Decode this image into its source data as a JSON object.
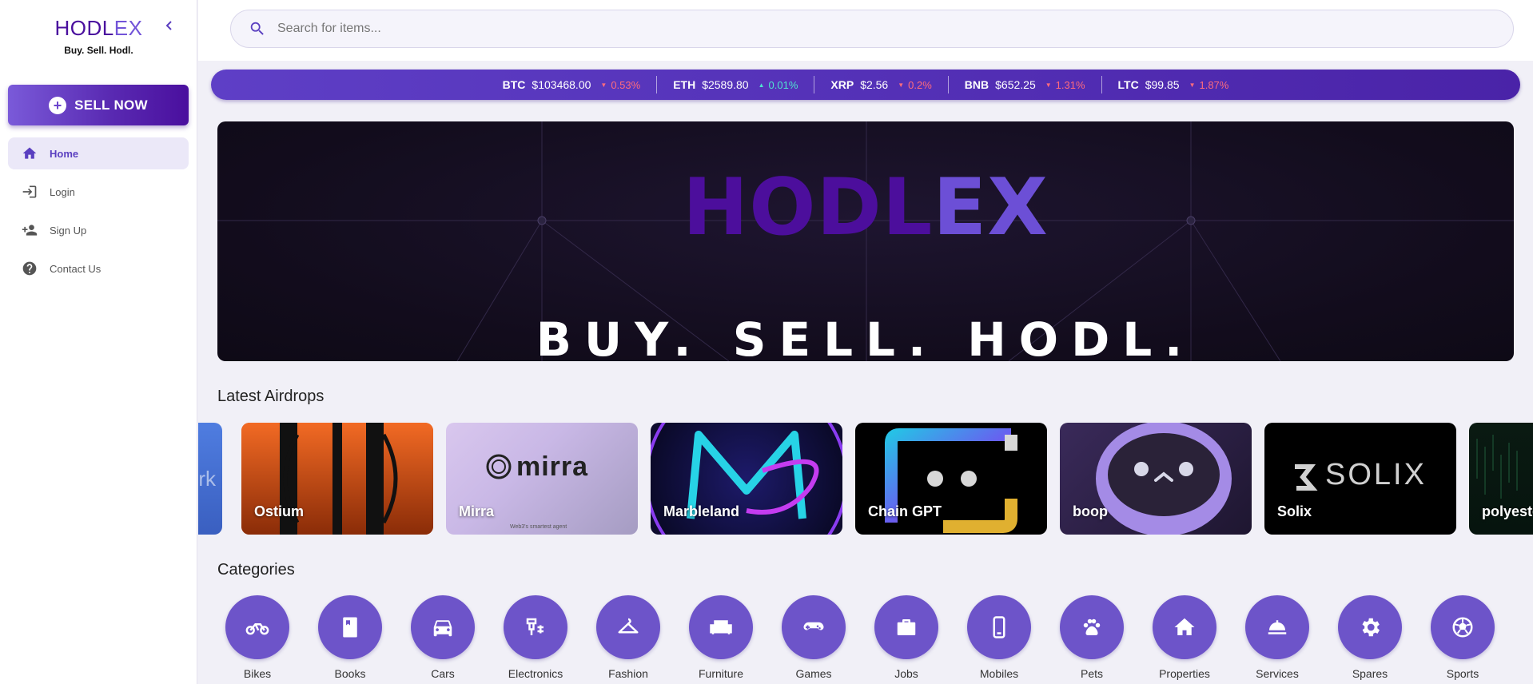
{
  "brand": {
    "name_part1": "HODL",
    "name_part2": "EX",
    "tagline": "Buy. Sell. Hodl."
  },
  "sidebar": {
    "collapse_icon": "chevron-left-icon",
    "sell_button": "SELL NOW",
    "items": [
      {
        "label": "Home",
        "icon": "home-icon",
        "active": true
      },
      {
        "label": "Login",
        "icon": "login-icon",
        "active": false
      },
      {
        "label": "Sign Up",
        "icon": "person-add-icon",
        "active": false
      },
      {
        "label": "Contact Us",
        "icon": "help-circle-icon",
        "active": false
      }
    ]
  },
  "search": {
    "placeholder": "Search for items..."
  },
  "ticker": [
    {
      "symbol": "BTC",
      "price": "$103468.00",
      "change": "0.53%",
      "direction": "down"
    },
    {
      "symbol": "ETH",
      "price": "$2589.80",
      "change": "0.01%",
      "direction": "up"
    },
    {
      "symbol": "XRP",
      "price": "$2.56",
      "change": "0.2%",
      "direction": "down"
    },
    {
      "symbol": "BNB",
      "price": "$652.25",
      "change": "1.31%",
      "direction": "down"
    },
    {
      "symbol": "LTC",
      "price": "$99.85",
      "change": "1.87%",
      "direction": "down"
    }
  ],
  "hero": {
    "logo_part1": "HODL",
    "logo_part2": "EX",
    "tagline": "BUY. SELL. HODL."
  },
  "airdrops": {
    "title": "Latest Airdrops",
    "items": [
      {
        "label": "",
        "partial_text": "rk"
      },
      {
        "label": "Ostium"
      },
      {
        "label": "Mirra",
        "logo_text": "mirra",
        "sub_text": "Web3's smartest agent"
      },
      {
        "label": "Marbleland"
      },
      {
        "label": "Chain GPT"
      },
      {
        "label": "boop"
      },
      {
        "label": "Solix",
        "logo_text": "SOLIX"
      },
      {
        "label": "polyeste"
      }
    ]
  },
  "categories": {
    "title": "Categories",
    "items": [
      {
        "label": "Bikes",
        "icon": "motorcycle-icon"
      },
      {
        "label": "Books",
        "icon": "book-icon"
      },
      {
        "label": "Cars",
        "icon": "car-icon"
      },
      {
        "label": "Electronics",
        "icon": "plug-icon"
      },
      {
        "label": "Fashion",
        "icon": "hanger-icon"
      },
      {
        "label": "Furniture",
        "icon": "sofa-icon"
      },
      {
        "label": "Games",
        "icon": "gamepad-icon"
      },
      {
        "label": "Jobs",
        "icon": "briefcase-icon"
      },
      {
        "label": "Mobiles",
        "icon": "phone-icon"
      },
      {
        "label": "Pets",
        "icon": "paw-icon"
      },
      {
        "label": "Properties",
        "icon": "house-icon"
      },
      {
        "label": "Services",
        "icon": "service-bell-icon"
      },
      {
        "label": "Spares",
        "icon": "gear-icon"
      },
      {
        "label": "Sports",
        "icon": "ball-icon"
      }
    ]
  },
  "colors": {
    "accent": "#6d54c9",
    "brand_dark": "#4a0f9e",
    "down": "#ff6b7d",
    "up": "#4fe3d0"
  }
}
